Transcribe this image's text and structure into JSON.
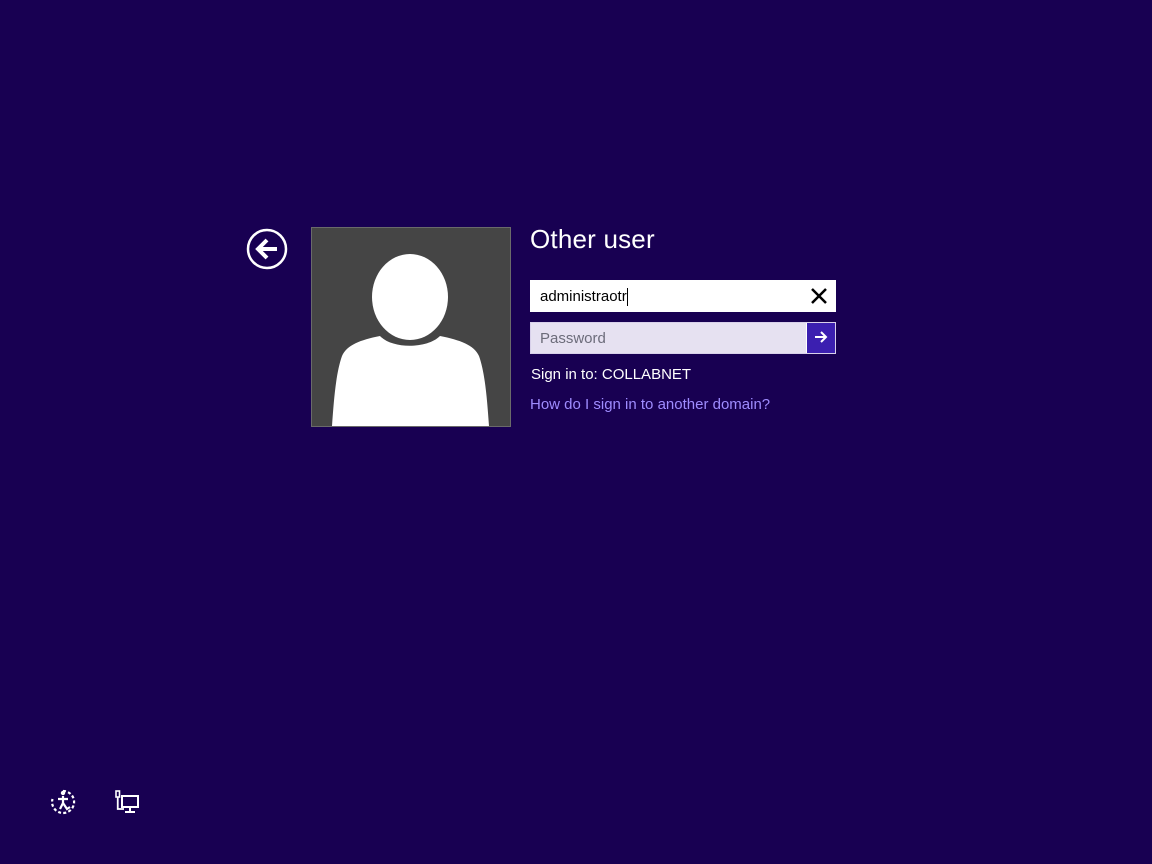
{
  "login": {
    "title": "Other user",
    "username_value": "administraotr",
    "password_placeholder": "Password",
    "sign_in_to": "Sign in to: COLLABNET",
    "domain_help_link": "How do I sign in to another domain?"
  },
  "icons": {
    "back": "back-arrow-icon",
    "user": "user-silhouette-icon",
    "clear": "close-icon",
    "submit": "arrow-right-icon",
    "ease_of_access": "ease-of-access-icon",
    "network": "network-icon"
  },
  "colors": {
    "background": "#180052",
    "accent": "#3b1fb0",
    "link": "#9f8cff",
    "tile": "#454545"
  }
}
